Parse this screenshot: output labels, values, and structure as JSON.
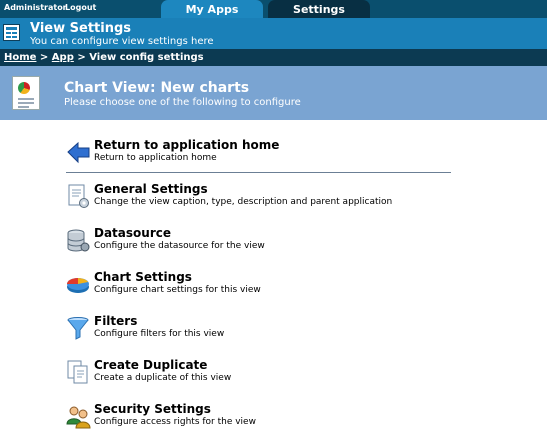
{
  "topbar": {
    "user": "Administrator",
    "logout": "Logout"
  },
  "tabs": [
    {
      "label": "My Apps",
      "active": true
    },
    {
      "label": "Settings",
      "active": false
    }
  ],
  "header": {
    "title": "View Settings",
    "subtitle": "You can configure view settings here"
  },
  "breadcrumb": {
    "home": "Home",
    "sep1": " > ",
    "app": "App",
    "sep2": " > ",
    "current": "View config settings"
  },
  "banner": {
    "title": "Chart View: New charts",
    "subtitle": "Please choose one of the following to configure"
  },
  "menu": [
    {
      "title": "Return to application home",
      "desc": "Return to application home",
      "icon": "back-arrow-icon"
    },
    {
      "title": "General Settings",
      "desc": "Change the view caption, type, description and parent application",
      "icon": "document-gear-icon"
    },
    {
      "title": "Datasource",
      "desc": "Configure the datasource for the view",
      "icon": "database-icon"
    },
    {
      "title": "Chart Settings",
      "desc": "Configure chart settings for this view",
      "icon": "pie-chart-icon"
    },
    {
      "title": "Filters",
      "desc": "Configure filters for this view",
      "icon": "funnel-icon"
    },
    {
      "title": "Create Duplicate",
      "desc": "Create a duplicate of this view",
      "icon": "copy-icon"
    },
    {
      "title": "Security Settings",
      "desc": "Configure access rights for the view",
      "icon": "users-icon"
    }
  ],
  "colors": {
    "topbar": "#0a4f6e",
    "header": "#1a80b8",
    "breadcrumb": "#0c3a52",
    "banner": "#7aa4d2"
  }
}
